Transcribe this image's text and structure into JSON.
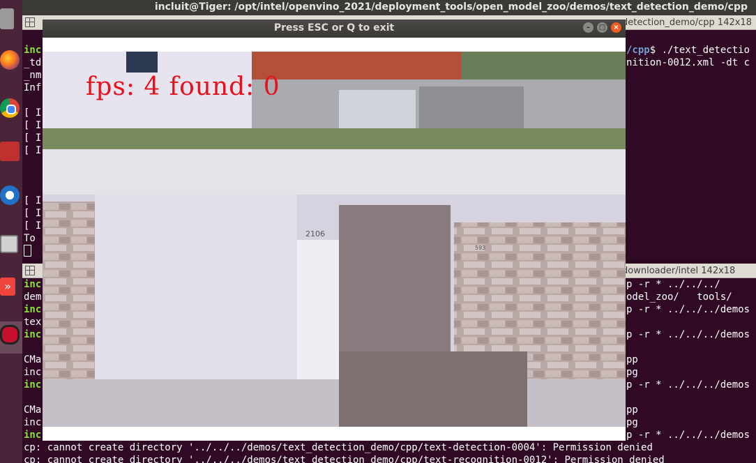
{
  "topbar": {
    "title": "incluit@Tiger: /opt/intel/openvino_2021/deployment_tools/open_model_zoo/demos/text_detection_demo/cpp"
  },
  "dock": {
    "items": [
      "files-icon",
      "firefox-icon",
      "chrome-icon",
      "terminal-icon",
      "thunderbird-icon",
      "camera-icon",
      "anydesk-icon",
      "opencv-window-icon"
    ]
  },
  "terminal_top": {
    "title": "detection_demo/cpp 142x18",
    "lines": [
      {
        "a": "inc",
        "b": "/cpp",
        "c": "$ ./text_detectio"
      },
      {
        "a": "_td",
        "c": "nition-0012.xml -dt c"
      },
      {
        "a": "_nm"
      },
      {
        "a": "Inf"
      },
      {
        "a": ""
      },
      {
        "a": "[ I"
      },
      {
        "a": "[ I"
      },
      {
        "a": "[ I"
      },
      {
        "a": "[ I"
      },
      {
        "a": ""
      },
      {
        "a": ""
      },
      {
        "a": ""
      },
      {
        "a": "[ I"
      },
      {
        "a": "[ I"
      },
      {
        "a": "[ I"
      },
      {
        "a": "To "
      }
    ]
  },
  "terminal_bottom": {
    "title": "downloader/intel 142x18",
    "left_lines": [
      "inc",
      "dem",
      "inc",
      "tex",
      "inc",
      "",
      "CMa",
      "inc",
      "inc",
      "",
      "CMa",
      "inc",
      "inc"
    ],
    "right_lines": [
      "p -r * ../../../",
      "odel_zoo/   tools/",
      "p -r * ../../../demos",
      "",
      "p -r * ../../../demos",
      "",
      "pp",
      "pg",
      "p -r * ../../../demos",
      "",
      "pp",
      "pg",
      "p -r * ../../../demos"
    ],
    "errors": [
      "cp: cannot create directory '../../../demos/text_detection_demo/cpp/text-detection-0004': Permission denied",
      "cp: cannot create directory '../../../demos/text_detection_demo/cpp/text-recognition-0012': Permission denied"
    ]
  },
  "window": {
    "title": "Press ESC or Q to exit",
    "overlay": "fps: 4 found: 0",
    "house_number": "2106",
    "pillar_number": "593"
  }
}
